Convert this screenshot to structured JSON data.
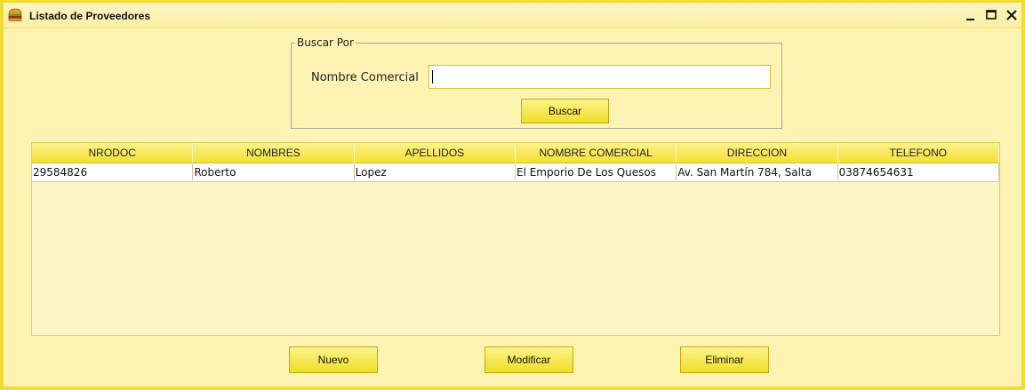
{
  "window": {
    "title": "Listado de Proveedores",
    "icon": "hamburger-icon",
    "controls": [
      "minimize-icon",
      "maximize-icon",
      "close-icon"
    ]
  },
  "search": {
    "group_label": "Buscar Por",
    "field_label": "Nombre Comercial",
    "value": "",
    "button_label": "Buscar"
  },
  "table": {
    "columns": [
      "NRODOC",
      "NOMBRES",
      "APELLIDOS",
      "NOMBRE COMERCIAL",
      "DIRECCION",
      "TELEFONO"
    ],
    "rows": [
      [
        "29584826",
        "Roberto",
        "Lopez",
        "El Emporio De Los Quesos",
        "Av. San Martín 784, Salta",
        "03874654631"
      ]
    ]
  },
  "actions": {
    "new_label": "Nuevo",
    "edit_label": "Modificar",
    "delete_label": "Eliminar"
  },
  "colors": {
    "background": "#fdf3b3",
    "border": "#f2dc2c",
    "button": "#f1de27"
  }
}
